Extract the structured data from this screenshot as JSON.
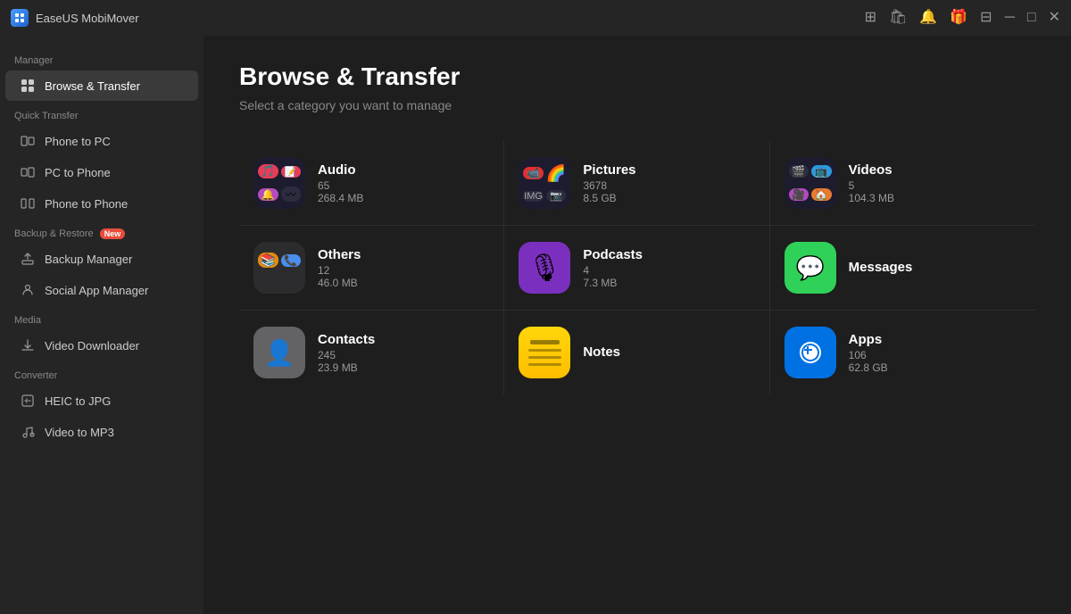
{
  "titleBar": {
    "appName": "EaseUS MobiMover",
    "icons": [
      "device-icon",
      "bag-icon",
      "bell-icon",
      "gift-icon",
      "dropdown-icon",
      "minimize-icon",
      "maximize-icon",
      "close-icon"
    ]
  },
  "sidebar": {
    "sections": [
      {
        "label": "Manager",
        "items": [
          {
            "id": "browse-transfer",
            "label": "Browse & Transfer",
            "icon": "grid",
            "active": true
          }
        ]
      },
      {
        "label": "Quick Transfer",
        "items": [
          {
            "id": "phone-to-pc",
            "label": "Phone to PC",
            "icon": "phone-pc"
          },
          {
            "id": "pc-to-phone",
            "label": "PC to Phone",
            "icon": "pc-phone"
          },
          {
            "id": "phone-to-phone",
            "label": "Phone to Phone",
            "icon": "phone-phone"
          }
        ]
      },
      {
        "label": "Backup & Restore",
        "badge": "New",
        "items": [
          {
            "id": "backup-manager",
            "label": "Backup Manager",
            "icon": "backup"
          },
          {
            "id": "social-app-manager",
            "label": "Social App Manager",
            "icon": "social"
          }
        ]
      },
      {
        "label": "Media",
        "items": [
          {
            "id": "video-downloader",
            "label": "Video Downloader",
            "icon": "video-dl"
          }
        ]
      },
      {
        "label": "Converter",
        "items": [
          {
            "id": "heic-to-jpg",
            "label": "HEIC to JPG",
            "icon": "heic"
          },
          {
            "id": "video-to-mp3",
            "label": "Video to MP3",
            "icon": "video-mp3"
          }
        ]
      }
    ]
  },
  "content": {
    "title": "Browse & Transfer",
    "subtitle": "Select a category you want to manage",
    "categories": [
      {
        "id": "audio",
        "name": "Audio",
        "count": "65",
        "size": "268.4 MB",
        "iconType": "audio"
      },
      {
        "id": "pictures",
        "name": "Pictures",
        "count": "3678",
        "size": "8.5 GB",
        "iconType": "pictures"
      },
      {
        "id": "videos",
        "name": "Videos",
        "count": "5",
        "size": "104.3 MB",
        "iconType": "videos"
      },
      {
        "id": "others",
        "name": "Others",
        "count": "12",
        "size": "46.0 MB",
        "iconType": "others"
      },
      {
        "id": "podcasts",
        "name": "Podcasts",
        "count": "4",
        "size": "7.3 MB",
        "iconType": "podcasts"
      },
      {
        "id": "messages",
        "name": "Messages",
        "count": "",
        "size": "",
        "iconType": "messages"
      },
      {
        "id": "contacts",
        "name": "Contacts",
        "count": "245",
        "size": "23.9 MB",
        "iconType": "contacts"
      },
      {
        "id": "notes",
        "name": "Notes",
        "count": "",
        "size": "",
        "iconType": "notes"
      },
      {
        "id": "apps",
        "name": "Apps",
        "count": "106",
        "size": "62.8 GB",
        "iconType": "apps"
      }
    ]
  }
}
